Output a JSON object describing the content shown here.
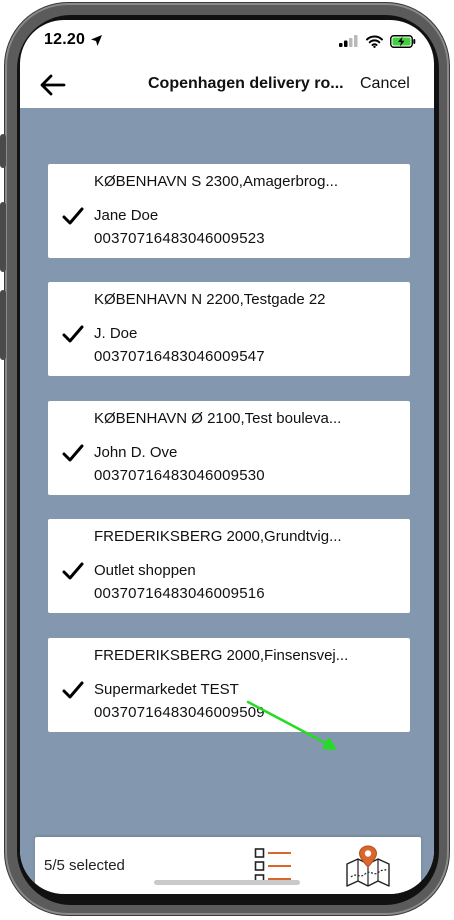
{
  "status_bar": {
    "time": "12.20"
  },
  "nav": {
    "title": "Copenhagen delivery ro...",
    "cancel_label": "Cancel"
  },
  "deliveries": [
    {
      "address": "KØBENHAVN S 2300,Amagerbrog...",
      "name": "Jane Doe",
      "code": "00370716483046009523",
      "checked": true
    },
    {
      "address": "KØBENHAVN N 2200,Testgade 22",
      "name": "J. Doe",
      "code": "00370716483046009547",
      "checked": true
    },
    {
      "address": "KØBENHAVN Ø 2100,Test bouleva...",
      "name": "John D. Ove",
      "code": "00370716483046009530",
      "checked": true
    },
    {
      "address": "FREDERIKSBERG 2000,Grundtvig...",
      "name": "Outlet shoppen",
      "code": "00370716483046009516",
      "checked": true
    },
    {
      "address": "FREDERIKSBERG 2000,Finsensvej...",
      "name": "Supermarkedet TEST",
      "code": "00370716483046009509",
      "checked": true
    }
  ],
  "bottom_bar": {
    "selected_text": "5/5 selected",
    "list_icon": "checklist-icon",
    "map_icon": "map-route-icon"
  },
  "colors": {
    "content_bg": "#8397ae",
    "accent_orange": "#d9662b",
    "annotation_arrow": "#22dd22"
  }
}
